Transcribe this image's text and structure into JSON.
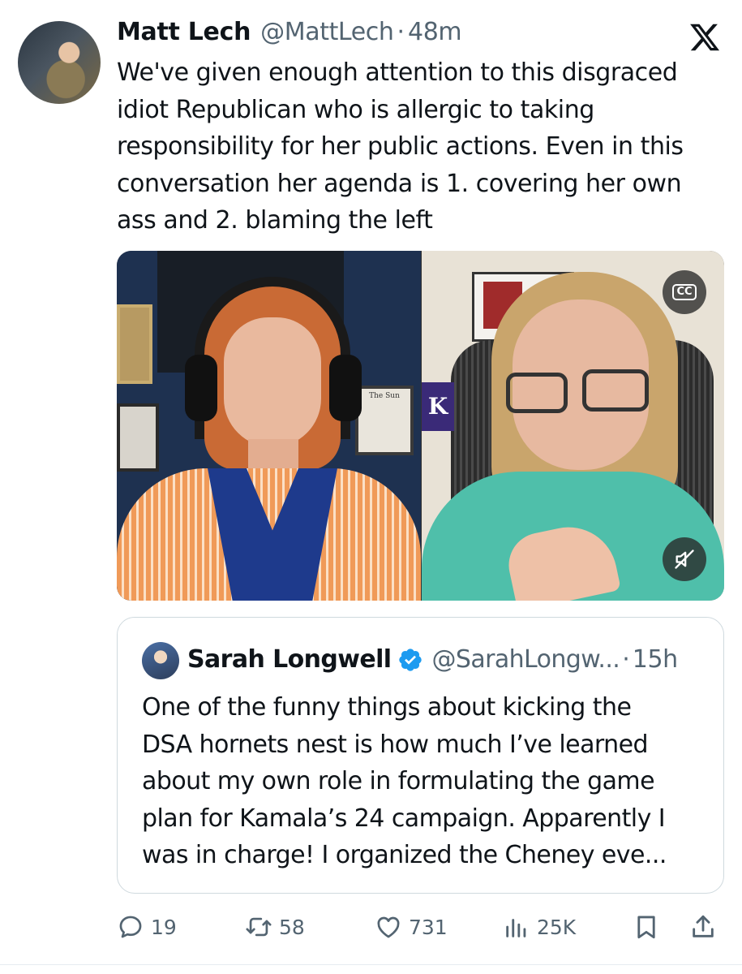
{
  "tweet": {
    "author_name": "Matt Lech",
    "author_handle": "@MattLech",
    "separator": "·",
    "time": "48m",
    "lines": [
      "We've given enough attention to this disgraced",
      "idiot Republican who is allergic to taking",
      "responsibility for her public actions. Even in this",
      "conversation her agenda is 1. covering her own",
      "ass and 2. blaming the left"
    ]
  },
  "media": {
    "cc_label": "CC",
    "newspaper_title": "The Sun",
    "pennant_letter": "K"
  },
  "quoted_tweet": {
    "author_name": "Sarah Longwell",
    "author_handle": "@SarahLongw...",
    "separator": "·",
    "time": "15h",
    "lines": [
      "One of the funny things about kicking the",
      "DSA hornets nest is how much I’ve learned",
      "about my own role in formulating the game",
      "plan for Kamala’s 24 campaign. Apparently I",
      "was in charge! I organized the Cheney eve..."
    ]
  },
  "actions": {
    "replies": "19",
    "reposts": "58",
    "likes": "731",
    "views": "25K"
  },
  "colors": {
    "text": "#0f1419",
    "secondary": "#536471",
    "verified": "#1d9bf0",
    "border": "#cfd9de"
  },
  "icons": [
    "x-logo-icon",
    "cc-icon",
    "mute-icon",
    "verified-icon",
    "reply-icon",
    "repost-icon",
    "like-icon",
    "views-icon",
    "bookmark-icon",
    "share-icon"
  ]
}
